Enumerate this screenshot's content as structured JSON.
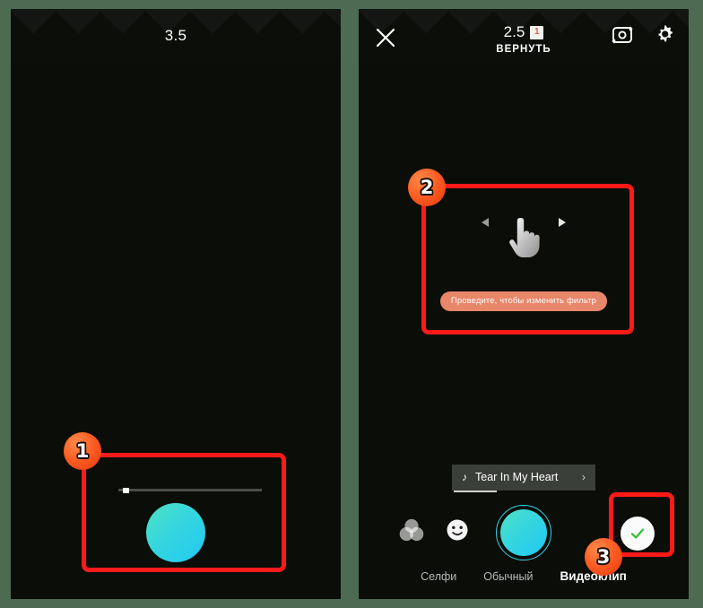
{
  "meta": {
    "outer_background": "#4d6b52",
    "panel_background": "#0a0d08",
    "accent_red": "#ff1a1a",
    "accent_orange": "#fb5f24",
    "shutter_gradient_from": "#4fe2c2",
    "shutter_gradient_to": "#1fc9f2",
    "hint_pill_color": "#e8866a"
  },
  "left_panel": {
    "timer": "3.5",
    "seek": {
      "value_percent": 3
    },
    "shutter_label": "shutter-button"
  },
  "right_panel": {
    "topbar": {
      "close_icon": "close-icon",
      "timer": "2.5",
      "segment_badge": "1",
      "undo_label": "ВЕРНУТЬ",
      "flip_camera_icon": "camera-flip-icon",
      "settings_icon": "gear-icon"
    },
    "swipe_hint": {
      "hand_icon": "swipe-hand-icon",
      "left_arrow_icon": "arrow-left-icon",
      "right_arrow_icon": "arrow-right-icon",
      "text": "Проведите, чтобы изменить фильтр"
    },
    "music": {
      "note_icon": "music-note-icon",
      "title": "Tear In My Heart",
      "chevron_icon": "chevron-right-icon"
    },
    "bottom": {
      "filters_icon": "color-filters-icon",
      "stickers_icon": "smiley-icon",
      "shutter_icon": "shutter-button",
      "confirm_icon": "check-icon"
    },
    "mode_tabs": [
      {
        "label": "Селфи",
        "active": false
      },
      {
        "label": "Обычный",
        "active": false
      },
      {
        "label": "Видеоклип",
        "active": true
      }
    ]
  },
  "annotations": [
    {
      "number": "1",
      "target": "left-shutter-area"
    },
    {
      "number": "2",
      "target": "swipe-filter-hint"
    },
    {
      "number": "3",
      "target": "confirm-button"
    }
  ]
}
